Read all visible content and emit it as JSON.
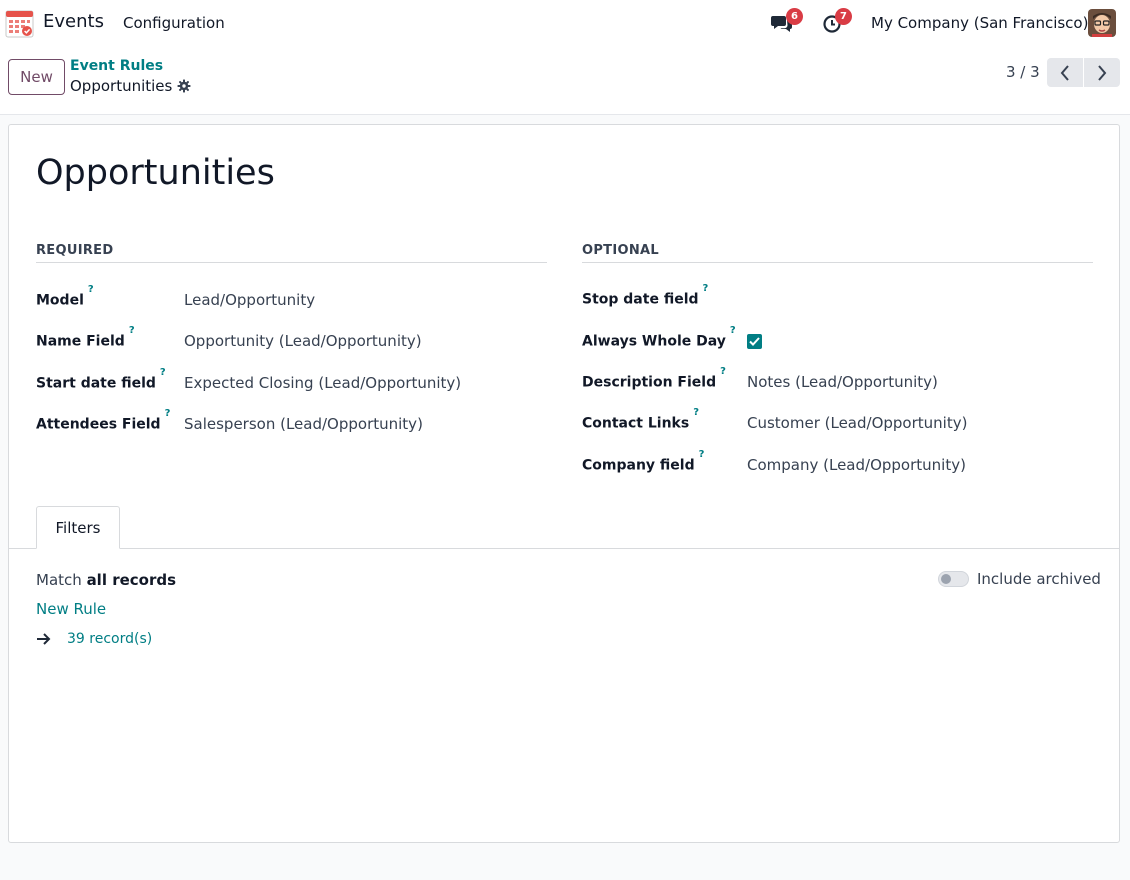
{
  "navbar": {
    "app_name": "Events",
    "menu_configuration": "Configuration",
    "chat_count": "6",
    "activity_count": "7",
    "company": "My Company (San Francisco)",
    "icons": [
      "calendar-app-icon",
      "chat-icon",
      "clock-icon",
      "avatar"
    ]
  },
  "control": {
    "new_label": "New",
    "breadcrumb_parent": "Event Rules",
    "breadcrumb_current": "Opportunities",
    "pager_value": "3 / 3"
  },
  "form": {
    "title": "Opportunities",
    "required": {
      "heading": "REQUIRED",
      "fields": [
        {
          "label": "Model",
          "value": "Lead/Opportunity"
        },
        {
          "label": "Name Field",
          "value": "Opportunity (Lead/Opportunity)"
        },
        {
          "label": "Start date field",
          "value": "Expected Closing (Lead/Opportunity)"
        },
        {
          "label": "Attendees Field",
          "value": "Salesperson (Lead/Opportunity)"
        }
      ]
    },
    "optional": {
      "heading": "OPTIONAL",
      "fields": [
        {
          "label": "Stop date field",
          "value": ""
        },
        {
          "label": "Always Whole Day",
          "value": "",
          "checked": true
        },
        {
          "label": "Description Field",
          "value": "Notes (Lead/Opportunity)"
        },
        {
          "label": "Contact Links",
          "value": "Customer (Lead/Opportunity)"
        },
        {
          "label": "Company field",
          "value": "Company (Lead/Opportunity)"
        }
      ]
    },
    "help_marker": "?"
  },
  "notebook": {
    "tab_filters": "Filters",
    "match_prefix": "Match",
    "match_bold": "all records",
    "include_archived": "Include archived",
    "include_archived_on": false,
    "new_rule": "New Rule",
    "records": "39 record(s)"
  },
  "colors": {
    "brand": "#714b67",
    "accent": "#017e84",
    "badge": "#d93c45"
  }
}
